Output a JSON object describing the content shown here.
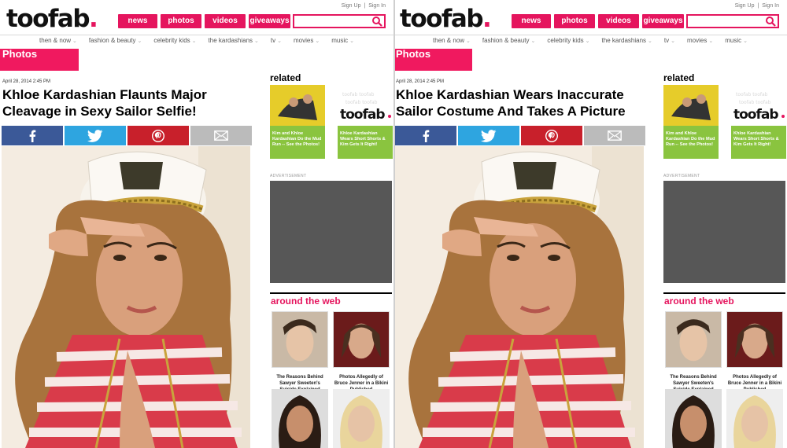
{
  "site": {
    "logo_text": "toofab",
    "logo_dot": ".",
    "sign_up": "Sign Up",
    "separator": "|",
    "sign_in": "Sign In",
    "nav": [
      "news",
      "photos",
      "videos",
      "giveaways"
    ],
    "subnav": [
      "then & now",
      "fashion & beauty",
      "celebrity kids",
      "the kardashians",
      "tv",
      "movies",
      "music"
    ],
    "subnav_chevron": "⌄",
    "section_label": "Photos"
  },
  "sidebar": {
    "related_heading": "related",
    "related": [
      {
        "caption": "Kim and Khloe Kardashian Do the Mud Run -- See the Photos!"
      },
      {
        "caption": "Khloe Kardashian Wears Short Shorts & Kim Gets It Right!"
      }
    ],
    "advertisement_label": "ADVERTISEMENT",
    "around_heading": "around the web",
    "around": [
      {
        "caption": "The Reasons Behind Sawyer Sweeten's Suicide Explained"
      },
      {
        "caption": "Photos Allegedly of Bruce Jenner in a Bikini Published"
      }
    ]
  },
  "left": {
    "date": "April 28, 2014 2:45 PM",
    "title": "Khloe Kardashian Flaunts Major Cleavage in Sexy Sailor Selfie!"
  },
  "right": {
    "date": "April 28, 2014 2:45 PM",
    "title": "Khloe Kardashian Wears Inaccurate Sailor Costume And Takes A Picture"
  },
  "colors": {
    "brand_pink": "#e5155e",
    "facebook": "#3b5998",
    "twitter": "#2ea5e0",
    "pinterest": "#c8202b",
    "email": "#bbbbbb",
    "related_green": "#8ac43f",
    "ad_gray": "#575757"
  },
  "icons": [
    "facebook-icon",
    "twitter-icon",
    "pinterest-icon",
    "email-icon",
    "search-icon"
  ]
}
